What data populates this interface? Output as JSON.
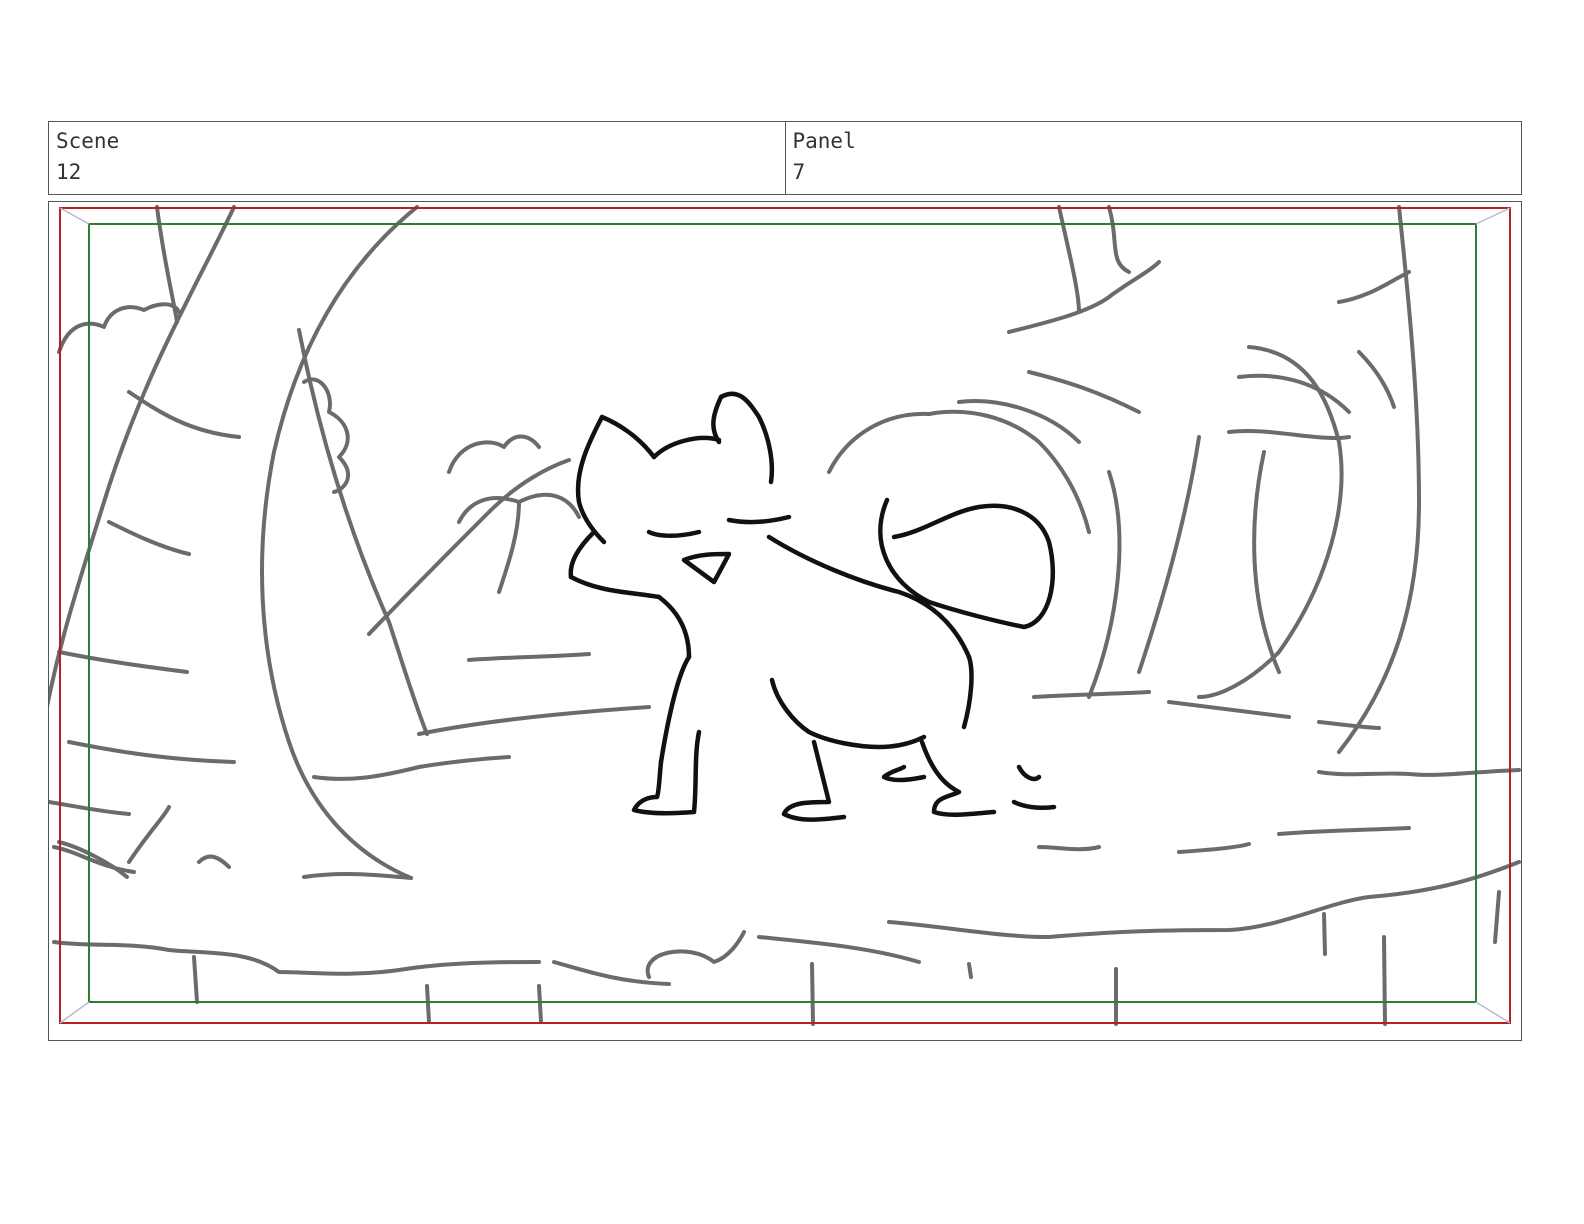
{
  "sheet": {
    "scene": {
      "label": "Scene",
      "value": "12"
    },
    "panel": {
      "label": "Panel",
      "value": "7"
    }
  },
  "artwork": {
    "description_icon": "storyboard-sketch-fox-in-jungle",
    "action_safe_color": "#b22222",
    "title_safe_color": "#2e7d32"
  }
}
